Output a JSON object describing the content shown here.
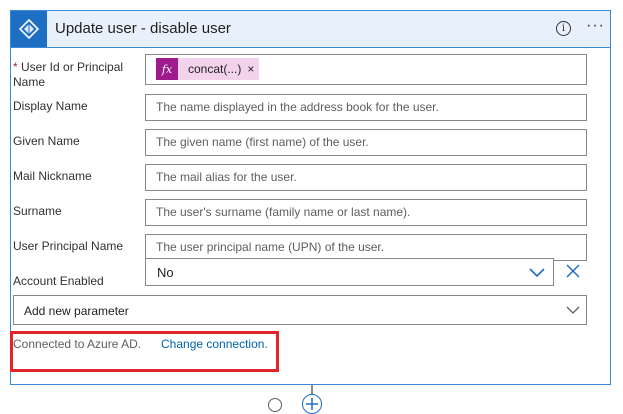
{
  "card": {
    "title": "Update user - disable user",
    "app_icon": "azure-ad-icon",
    "info_glyph": "i",
    "more_glyph": "···"
  },
  "fields": {
    "user_id": {
      "required_mark": "*",
      "label": "User Id or Principal Name",
      "token_fx": "fx",
      "token_text": "concat(...)",
      "token_close": "×"
    },
    "display_name": {
      "label": "Display Name",
      "placeholder": "The name displayed in the address book for the user."
    },
    "given_name": {
      "label": "Given Name",
      "placeholder": "The given name (first name) of the user."
    },
    "mail_nickname": {
      "label": "Mail Nickname",
      "placeholder": "The mail alias for the user."
    },
    "surname": {
      "label": "Surname",
      "placeholder": "The user's surname (family name or last name)."
    },
    "upn": {
      "label": "User Principal Name",
      "placeholder": "The user principal name (UPN) of the user."
    },
    "account_enabled": {
      "label": "Account Enabled",
      "value": "No"
    }
  },
  "add_parameter": {
    "label": "Add new parameter"
  },
  "connection": {
    "status": "Connected to Azure AD.",
    "change_link": "Change connection."
  },
  "colors": {
    "accent": "#1d6fc4",
    "header_bg": "#e8f1fb",
    "highlight_box": "#e3242b",
    "fx_token": "#9d1b8d",
    "link": "#0062ad"
  }
}
